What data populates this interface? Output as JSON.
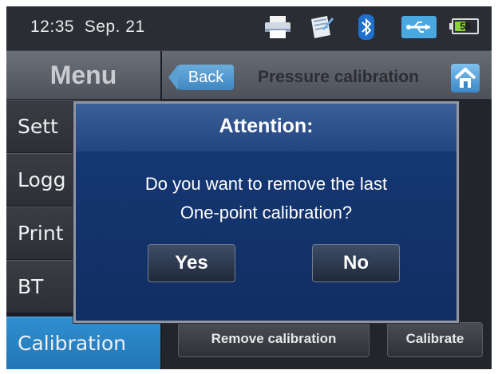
{
  "status_bar": {
    "time": "12:35",
    "date": "Sep. 21",
    "icons": [
      "printer-icon",
      "notepad-icon",
      "bluetooth-icon",
      "usb-icon"
    ],
    "battery_level": 50,
    "battery_text": "50"
  },
  "menu": {
    "title": "Menu",
    "items": [
      {
        "label": "Sett"
      },
      {
        "label": "Logg"
      },
      {
        "label": "Print"
      },
      {
        "label": "BT"
      },
      {
        "label": "Calibration"
      }
    ],
    "active_index": 4
  },
  "header": {
    "back_label": "Back",
    "title": "Pressure calibration"
  },
  "actions": {
    "remove_label": "Remove calibration",
    "calibrate_label": "Calibrate"
  },
  "dialog": {
    "title": "Attention:",
    "message_line1": "Do you want to remove the last",
    "message_line2": "One-point calibration?",
    "yes_label": "Yes",
    "no_label": "No"
  },
  "colors": {
    "accent": "#2b86c7",
    "dialog_bg": "#112e62",
    "battery_fill": "#8bd13a"
  }
}
